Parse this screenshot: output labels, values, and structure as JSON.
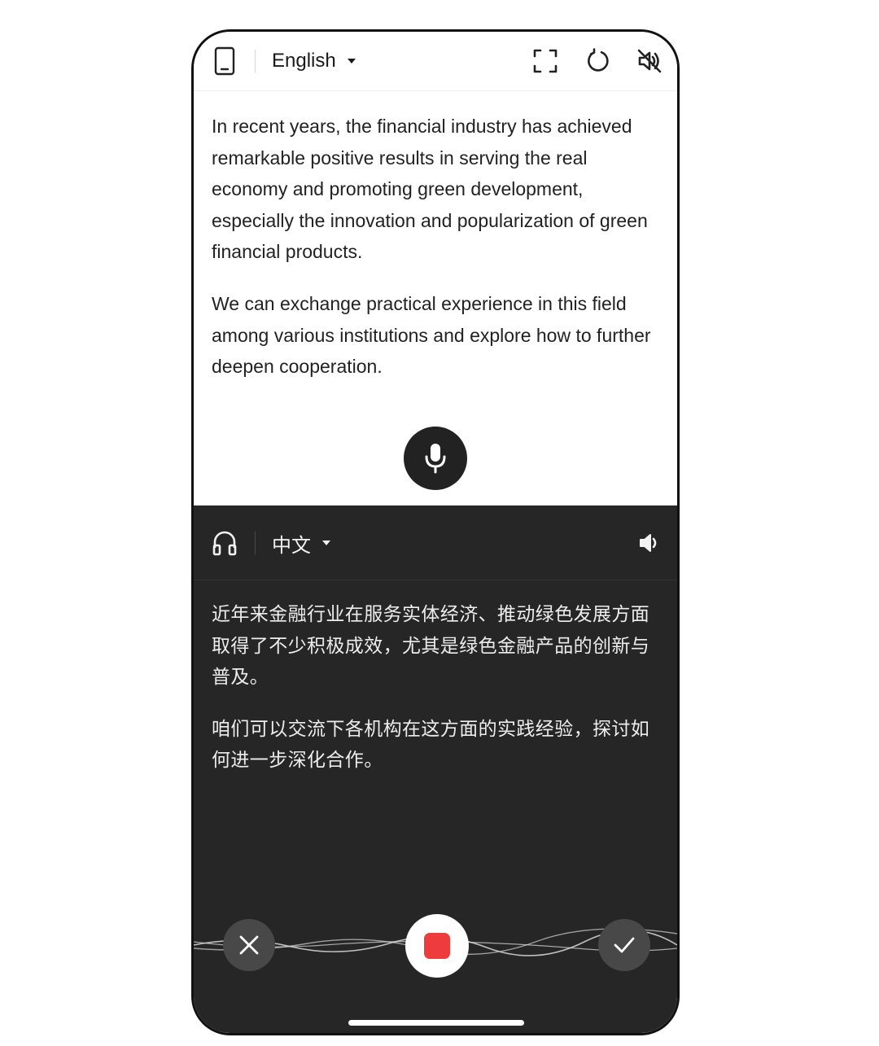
{
  "source_panel": {
    "language_label": "English",
    "paragraphs": [
      "In recent years, the financial industry has achieved remarkable positive results in serving the real economy and promoting green development, especially the innovation and popularization of green financial products.",
      "We can exchange practical experience in this field among various institutions and explore how to further deepen cooperation."
    ],
    "icons": {
      "device": "phone-icon",
      "fullscreen": "fullscreen-icon",
      "refresh": "refresh-icon",
      "mute": "speaker-muted-icon",
      "mic": "microphone-icon"
    }
  },
  "target_panel": {
    "language_label": "中文",
    "paragraphs": [
      "近年来金融行业在服务实体经济、推动绿色发展方面取得了不少积极成效，尤其是绿色金融产品的创新与普及。",
      "咱们可以交流下各机构在这方面的实践经验，探讨如何进一步深化合作。"
    ],
    "icons": {
      "audio_output": "headphones-icon",
      "speaker": "speaker-icon"
    }
  },
  "controls": {
    "cancel_icon": "close-icon",
    "stop_icon": "stop-icon",
    "confirm_icon": "checkmark-icon"
  },
  "colors": {
    "dark_panel": "#262626",
    "record_red": "#ee3b3b",
    "mic_button": "#222222"
  }
}
